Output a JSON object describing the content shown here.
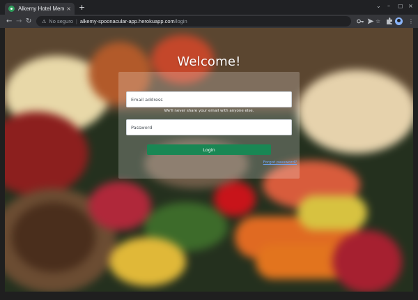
{
  "browser": {
    "tab_title": "Alkemy Hotel Menu",
    "tab_close": "×",
    "new_tab": "+",
    "window_controls": [
      "⌄",
      "–",
      "▢",
      "×"
    ],
    "nav": {
      "back": "←",
      "forward": "→",
      "reload": "↻"
    },
    "security_label": "No seguro",
    "url_host": "alkemy-spoonacular-app.herokuapp.com",
    "url_path": "/login",
    "icons": [
      "key-icon",
      "send-icon",
      "star-icon",
      "extensions-icon",
      "avatar",
      "menu-icon"
    ]
  },
  "login": {
    "title": "Welcome!",
    "email_placeholder": "Email address",
    "email_help": "We'll never share your email with anyone else.",
    "password_placeholder": "Password",
    "submit_label": "Login",
    "forgot_label": "Forgot password?"
  },
  "colors": {
    "primary_button": "#198754",
    "link": "#6ea8fe",
    "browser_chrome": "#35363a"
  }
}
